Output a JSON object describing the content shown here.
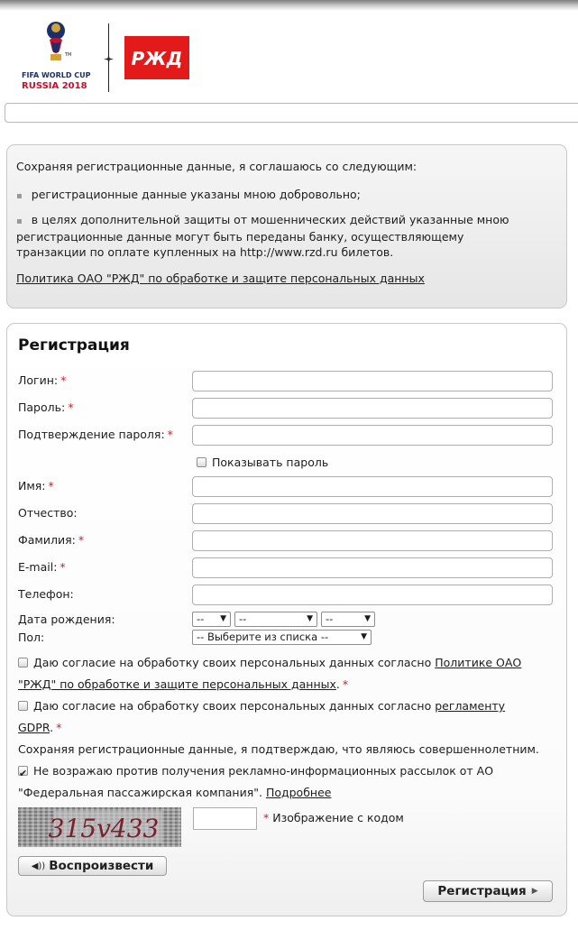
{
  "header": {
    "fifa_logo_text": [
      "FIFA WORLD CUP",
      "RUSSIA 2018"
    ],
    "rzd_logo_text": "РЖД"
  },
  "agreement": {
    "intro": "Сохраняя регистрационные данные, я соглашаюсь со следующим:",
    "bullets": [
      "регистрационные данные указаны мною добровольно;",
      "в целях дополнительной защиты от мошеннических действий указанные мною",
      "регистрационные данные могут быть переданы банку, осуществляющему",
      "транзакции по оплате купленных на http://www.rzd.ru билетов."
    ],
    "policy_link": "Политика ОАО \"РЖД\" по обработке и защите персональных данных"
  },
  "registration": {
    "title": "Регистрация",
    "required_mark": "*",
    "fields": {
      "login": "Логин:",
      "password": "Пароль:",
      "password_confirm": "Подтверждение пароля:",
      "show_password": "Показывать пароль",
      "first_name": "Имя:",
      "patronymic": "Отчество:",
      "last_name": "Фамилия:",
      "email": "E-mail:",
      "phone": "Телефон:",
      "birth_date": "Дата рождения:",
      "gender": "Пол:"
    },
    "birth_date_selects": [
      "--",
      "--",
      "--"
    ],
    "gender_select": "-- Выберите из списка --",
    "consent_pd_text": "Даю согласие на обработку своих персональных данных согласно",
    "consent_pd_link_1": "Политике ОАО",
    "consent_pd_link_2": "\"РЖД\" по обработке и защите персональных данных",
    "consent_pd_end": ".",
    "consent_gdpr_text": "Даю согласие на обработку своих персональных данных согласно",
    "consent_gdpr_link_1": "регламенту",
    "consent_gdpr_link_2": "GDPR",
    "consent_gdpr_end": ".",
    "adult_confirm": "Сохраняя регистрационные данные, я подтверждаю, что являюсь совершеннолетним.",
    "ads_consent_1": "Не возражаю против получения рекламно-информационных рассылок от АО",
    "ads_consent_2": "\"Федеральная пассажирская компания\".",
    "ads_more_link": "Подробнее",
    "ads_consent_checked": true,
    "captcha_code": "315v433",
    "captcha_label": "Изображение с кодом",
    "play_button": "Воспроизвести",
    "submit_button": "Регистрация"
  },
  "colors": {
    "required": "#c0262d",
    "rzd_red": "#e21a1a"
  }
}
